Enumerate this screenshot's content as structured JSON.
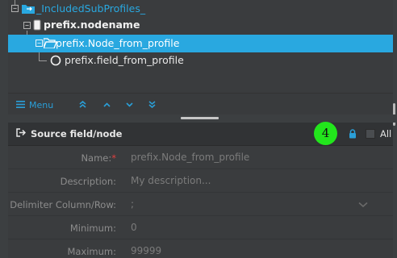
{
  "tree": {
    "items": [
      {
        "label": "_IncludedSubProfiles_",
        "kind": "folder-link",
        "color": "#29a8e0"
      },
      {
        "label": "prefix.nodename",
        "kind": "node-root"
      },
      {
        "label": "prefix.Node_from_profile",
        "kind": "folder-open",
        "selected": true
      },
      {
        "label": "prefix.field_from_profile",
        "kind": "field"
      }
    ]
  },
  "toolbar": {
    "menu_label": "Menu",
    "buttons": [
      "move-top-icon",
      "move-up-icon",
      "move-down-icon",
      "move-bottom-icon"
    ]
  },
  "source": {
    "title": "Source field/node",
    "badge": "4",
    "all_label": "All"
  },
  "form": {
    "name_label": "Name:",
    "name_required": "*",
    "name_value": "prefix.Node_from_profile",
    "description_label": "Description:",
    "description_placeholder": "My description...",
    "delimiter_label": "Delimiter Column/Row:",
    "delimiter_value": ";",
    "minimum_label": "Minimum:",
    "minimum_value": "0",
    "maximum_label": "Maximum:",
    "maximum_value": "99999"
  },
  "colors": {
    "accent": "#29a8e0",
    "selection": "#29a8e0",
    "badge": "#22e61c",
    "required": "#e04040"
  }
}
